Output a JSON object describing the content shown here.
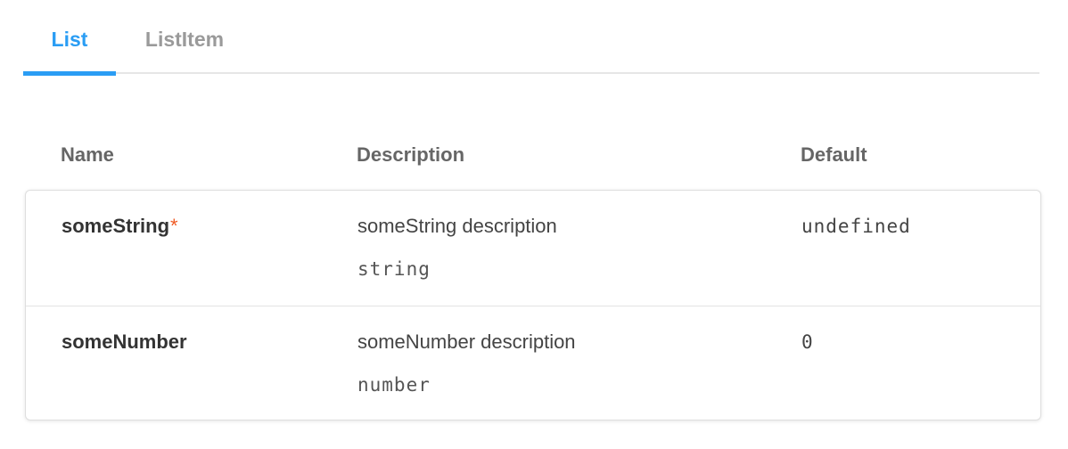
{
  "tabs": [
    {
      "label": "List",
      "active": true
    },
    {
      "label": "ListItem",
      "active": false
    }
  ],
  "colors": {
    "accent": "#2a9df4",
    "required": "#ef5b25",
    "inactive_tab": "#9a9a9a"
  },
  "table": {
    "headers": {
      "name": "Name",
      "description": "Description",
      "default": "Default"
    },
    "rows": [
      {
        "name": "someString",
        "required": true,
        "required_mark": "*",
        "description": "someString description",
        "type": "string",
        "default": "undefined"
      },
      {
        "name": "someNumber",
        "required": false,
        "required_mark": "",
        "description": "someNumber description",
        "type": "number",
        "default": "0"
      }
    ]
  }
}
